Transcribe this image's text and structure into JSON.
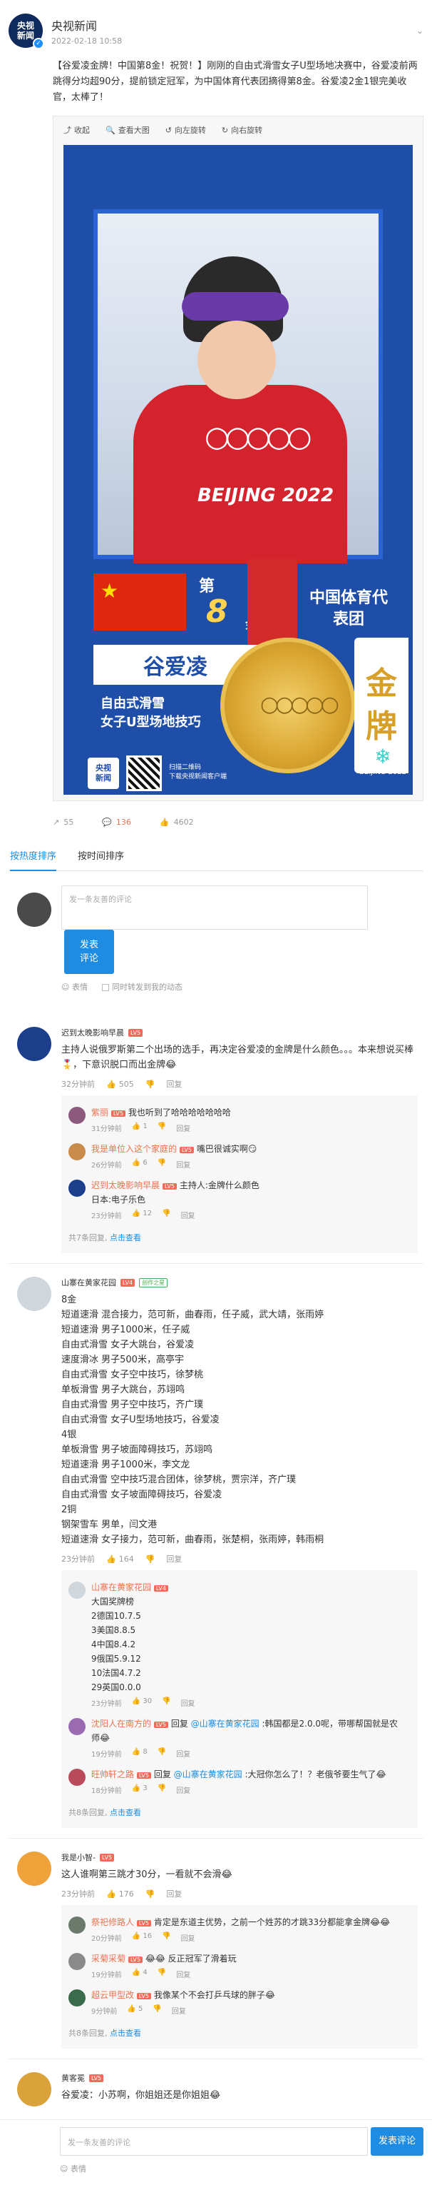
{
  "post": {
    "avatar_text": "央视\n新闻",
    "name": "央视新闻",
    "time": "2022-02-18 10:58",
    "text_prefix": "【谷爱凌金牌！中国第8金！祝贺！】",
    "text_body": "刚刚的自由式滑雪女子U型场地决赛中，谷爱凌前两跳得分均超90分，提前锁定冠军，为中国体育代表团摘得第8金。谷爱凌2金1银完美收官，太棒了！"
  },
  "media_toolbar": [
    "收起",
    "查看大图",
    "向左旋转",
    "向右旋转"
  ],
  "poster": {
    "beijing": "BEIJING 2022",
    "rank_label": "第",
    "rank_num": "8",
    "gold_label": "金",
    "team": "中国体育代表团",
    "athlete": "谷爱凌",
    "event_line1": "自由式滑雪",
    "event_line2": "女子U型场地技巧",
    "jinpai_1": "金",
    "jinpai_2": "牌",
    "logo": "央视\n新闻",
    "qr_line1": "扫描二维码",
    "qr_line2": "下载央视新闻客户端",
    "bj_logo": "BEIJING 2022"
  },
  "post_actions": {
    "share": "55",
    "comment": "136",
    "like": "4602"
  },
  "tabs": [
    "按热度排序",
    "按时间排序"
  ],
  "composer": {
    "placeholder": "发一条友善的评论",
    "button": "发表\n评论",
    "emoji": "表情",
    "also_post": "同时转发到我的动态"
  },
  "comments": [
    {
      "name": "迟到太晚影响早晨",
      "badge": "LV5",
      "text": "主持人说俄罗斯第二个出场的选手，再决定谷爱凌的金牌是什么颜色。。。本来想说买棒🎖️，下意识脱口而出金牌😂",
      "time": "32分钟前",
      "likes": "505",
      "reply": "回复",
      "subs": [
        {
          "name": "紫丽",
          "badge": "LV5",
          "text": "我也听到了哈哈哈哈哈哈哈",
          "time": "31分钟前",
          "likes": "1",
          "reply": "回复"
        },
        {
          "name": "我是单位入这个家庭的",
          "badge": "LV5",
          "text": "嘴巴很诚实啊😏",
          "time": "26分钟前",
          "likes": "6",
          "reply": "回复"
        },
        {
          "name": "迟到太晚影响早晨",
          "badge": "LV5",
          "text": "主持人:金牌什么颜色\n日本:电子乐色",
          "time": "23分钟前",
          "likes": "12",
          "reply": "回复"
        }
      ],
      "more": "共7条回复, ",
      "more_link": "点击查看"
    },
    {
      "name": "山寨在黄家花园",
      "badge": "LV4",
      "badge2": "创作之星",
      "text": "8金\n短道速滑 混合接力，范可新，曲春雨，任子威，武大靖，张雨婷\n短道速滑 男子1000米，任子威\n自由式滑雪 女子大跳台，谷爱凌\n速度滑冰 男子500米，高亭宇\n自由式滑雪 女子空中技巧，徐梦桃\n单板滑雪 男子大跳台，苏翊鸣\n自由式滑雪 男子空中技巧，齐广璞\n自由式滑雪 女子U型场地技巧，谷爱凌\n4银\n单板滑雪 男子坡面障碍技巧，苏翊鸣\n短道速滑 男子1000米，李文龙\n自由式滑雪 空中技巧混合团体，徐梦桃，贾宗洋，齐广璞\n自由式滑雪 女子坡面障碍技巧，谷爱凌\n2铜\n钢架雪车 男单，闫文港\n短道速滑 女子接力，范可新，曲春雨，张楚桐，张雨婷，韩雨桐",
      "time": "23分钟前",
      "likes": "164",
      "reply": "回复",
      "subs": [
        {
          "name": "山寨在黄家花园",
          "badge": "LV4",
          "text": "大国奖牌榜\n2德国10.7.5\n3美国8.8.5\n4中国8.4.2\n9俄国5.9.12\n10法国4.7.2\n29英国0.0.0",
          "time": "23分钟前",
          "likes": "30",
          "reply": "回复"
        },
        {
          "name": "沈阳人在南方的",
          "badge": "LV5",
          "text_reply": "回复 ",
          "text_at": "@山寨在黄家花园",
          "text_after": " :韩国都是2.0.0呢，带哪帮国就是农师😂",
          "time": "19分钟前",
          "likes": "8",
          "reply": "回复"
        },
        {
          "name": "旺帅轩之路",
          "badge": "LV5",
          "text_reply": "回复 ",
          "text_at": "@山寨在黄家花园",
          "text_after": " :大冠你怎么了！？老俄爷要生气了😂",
          "time": "18分钟前",
          "likes": "3",
          "reply": "回复"
        }
      ],
      "more": "共8条回复, ",
      "more_link": "点击查看"
    },
    {
      "name": "我是小智-",
      "badge": "LV5",
      "text": "这人谁啊第三跳才30分，一看就不会滑😂",
      "time": "23分钟前",
      "likes": "176",
      "reply": "回复",
      "subs": [
        {
          "name": "祭祀修路人",
          "badge": "LV5",
          "text": "肯定是东道主优势，之前一个姓苏的才跳33分都能拿金牌😂😂",
          "time": "20分钟前",
          "likes": "16",
          "reply": "回复"
        },
        {
          "name": "采菊采菊",
          "badge": "LV5",
          "text": "😂😂 反正冠军了滑着玩",
          "time": "19分钟前",
          "likes": "4",
          "reply": "回复"
        },
        {
          "name": "超云甲型改",
          "badge": "LV5",
          "text": "我像某个不会打乒乓球的胖子😂",
          "time": "9分钟前",
          "likes": "5",
          "reply": "回复"
        }
      ],
      "more": "共8条回复, ",
      "more_link": "点击查看"
    },
    {
      "name": "黄客冕",
      "badge": "LV5",
      "text": "谷爱凌：小苏啊，你姐姐还是你姐姐😂",
      "time": "",
      "likes": "",
      "reply": "",
      "subs": []
    }
  ],
  "bottom": {
    "placeholder": "发一条友善的评论",
    "button": "发表评论",
    "emoji": "表情"
  },
  "colors": {
    "accent": "#1e8ce3",
    "orange": "#eb7350",
    "poster_blue": "#1f4ea8"
  }
}
